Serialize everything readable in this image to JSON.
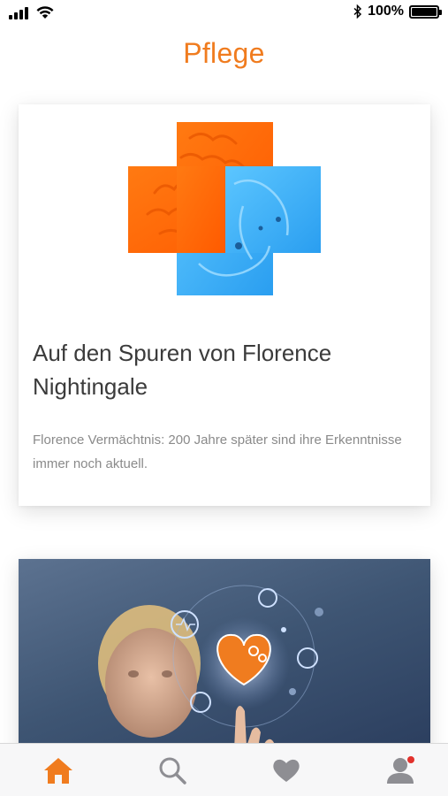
{
  "status_bar": {
    "battery_percent": "100%",
    "icons": [
      "signal-icon",
      "wifi-icon",
      "bluetooth-icon",
      "battery-icon"
    ]
  },
  "header": {
    "title": "Pflege"
  },
  "articles": [
    {
      "heading": "Auf den Spuren von Florence Nightingale",
      "teaser": "Florence Vermächtnis: 200 Jahre später sind ihre Erkenntnisse immer noch aktuell.",
      "image": "orange-blue-cross-brain-heart-illustration"
    },
    {
      "image": "woman-touching-heart-health-icons"
    }
  ],
  "tab_bar": {
    "tabs": [
      {
        "name": "home",
        "icon": "home-icon",
        "active": true
      },
      {
        "name": "search",
        "icon": "search-icon",
        "active": false
      },
      {
        "name": "favorites",
        "icon": "heart-icon",
        "active": false
      },
      {
        "name": "profile",
        "icon": "user-icon",
        "active": false,
        "badge": true
      }
    ]
  },
  "colors": {
    "accent": "#f07c1f",
    "cross_orange": "#ff6a00",
    "cross_blue": "#3aaef5",
    "inactive_icon": "#8e8e93",
    "badge": "#e2312c"
  }
}
